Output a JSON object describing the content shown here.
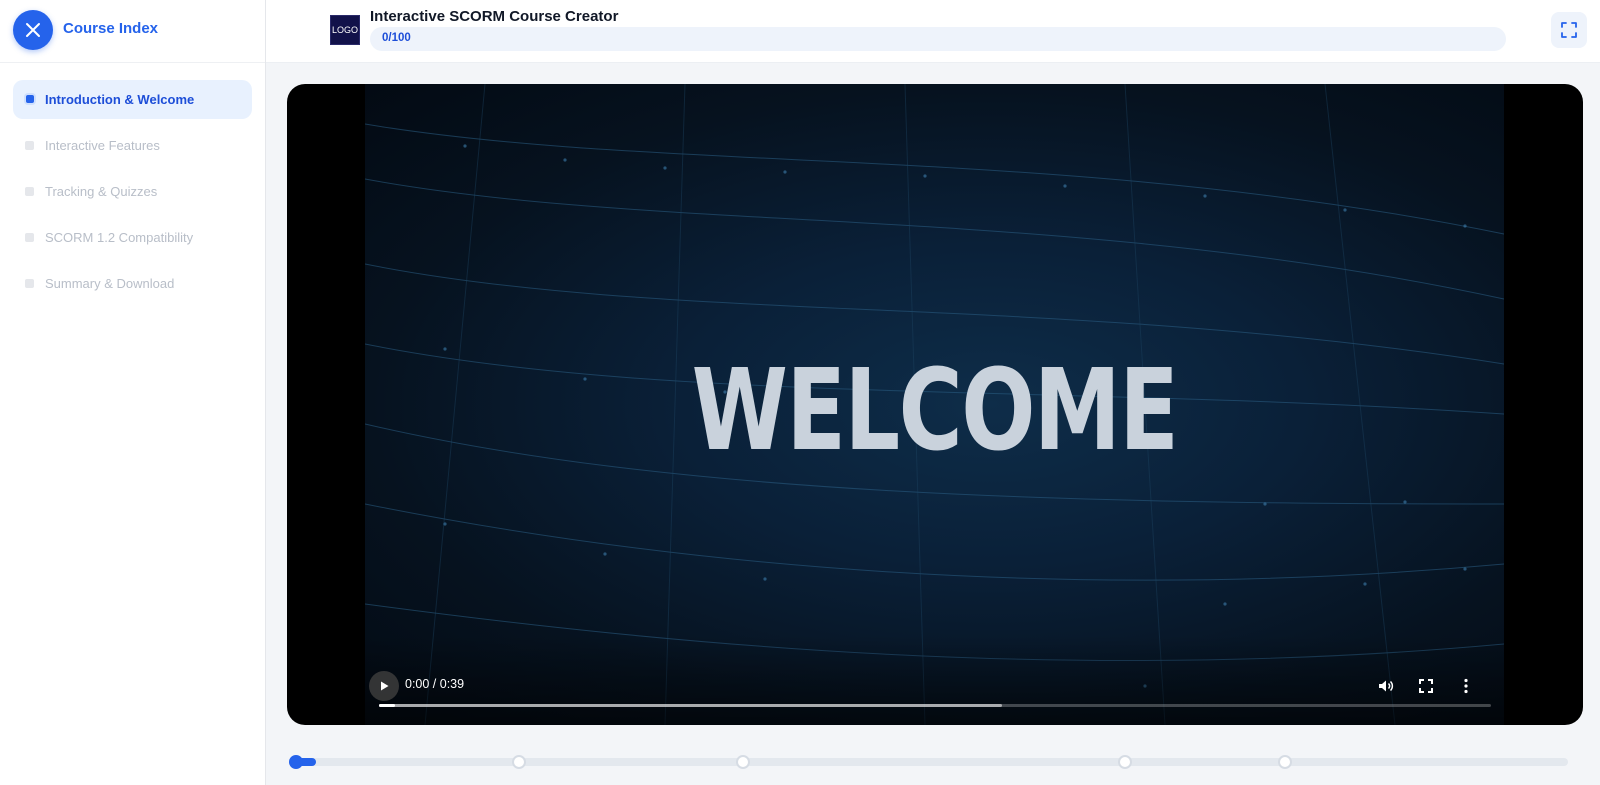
{
  "sidebar": {
    "title": "Course Index",
    "items": [
      {
        "label": "Introduction & Welcome",
        "active": true
      },
      {
        "label": "Interactive Features",
        "active": false
      },
      {
        "label": "Tracking & Quizzes",
        "active": false
      },
      {
        "label": "SCORM 1.2 Compatibility",
        "active": false
      },
      {
        "label": "Summary & Download",
        "active": false
      }
    ]
  },
  "header": {
    "logo_text": "LOGO",
    "title": "Interactive SCORM Course Creator",
    "progress_text": "0/100",
    "progress_fraction": 0
  },
  "video": {
    "overlay_text": "WELCOME",
    "time_display": "0:00 / 0:39",
    "played_fraction": 0.0,
    "buffered_fraction": 0.56
  },
  "steps": {
    "count": 5,
    "current_index": 0
  },
  "colors": {
    "accent": "#2563eb",
    "accent_light": "#e8f1fe",
    "muted_text": "#b8bec8"
  }
}
